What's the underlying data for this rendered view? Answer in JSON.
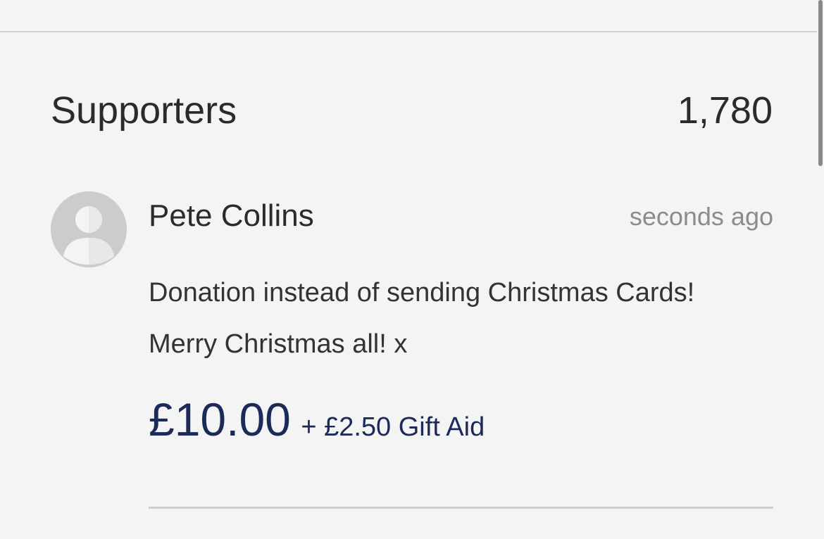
{
  "supporters": {
    "title": "Supporters",
    "count": "1,780"
  },
  "items": [
    {
      "avatar_icon": "default-user-avatar-icon",
      "name": "Pete Collins",
      "time": "seconds ago",
      "message_lines": [
        "Donation instead of sending Christmas Cards!",
        "Merry Christmas all! x"
      ],
      "amount": "£10.00",
      "gift_aid": "+ £2.50 Gift Aid"
    }
  ],
  "colors": {
    "background": "#f4f4f4",
    "amount": "#1b2a58",
    "timestamp": "#8c8c8c",
    "avatar": "#cccccc"
  }
}
